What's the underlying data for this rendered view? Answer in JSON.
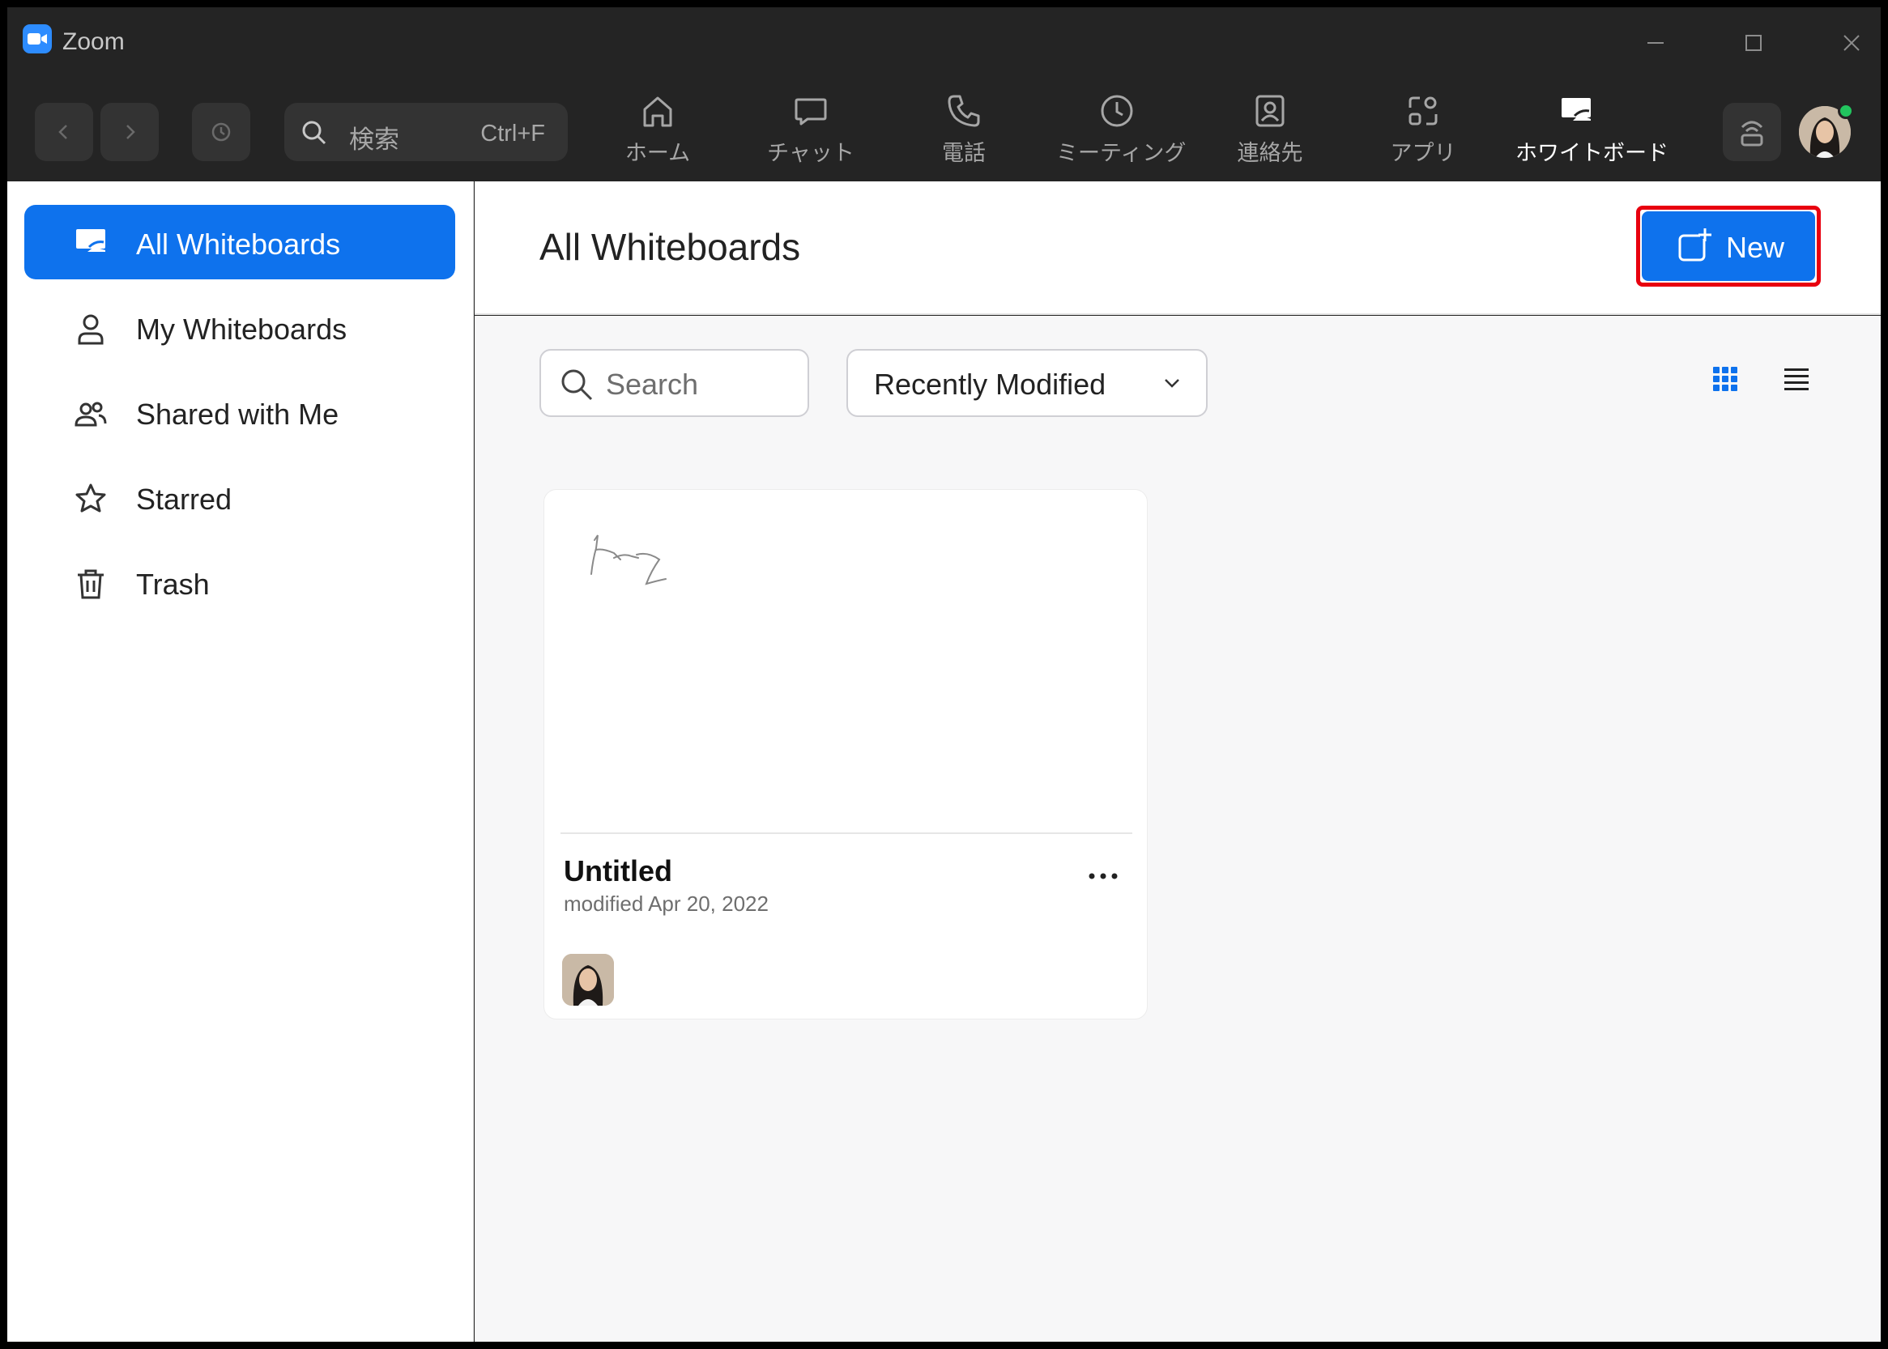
{
  "window": {
    "title": "Zoom"
  },
  "toolbar": {
    "search_placeholder": "検索",
    "search_shortcut": "Ctrl+F",
    "tabs": [
      {
        "label": "ホーム",
        "icon": "home-icon"
      },
      {
        "label": "チャット",
        "icon": "chat-icon"
      },
      {
        "label": "電話",
        "icon": "phone-icon"
      },
      {
        "label": "ミーティング",
        "icon": "clock-icon"
      },
      {
        "label": "連絡先",
        "icon": "contacts-icon"
      },
      {
        "label": "アプリ",
        "icon": "apps-icon"
      },
      {
        "label": "ホワイトボード",
        "icon": "whiteboard-icon",
        "active": true
      }
    ]
  },
  "sidebar": {
    "items": [
      {
        "label": "All Whiteboards",
        "icon": "whiteboard-icon",
        "active": true
      },
      {
        "label": "My Whiteboards",
        "icon": "person-icon"
      },
      {
        "label": "Shared with Me",
        "icon": "people-icon"
      },
      {
        "label": "Starred",
        "icon": "star-icon"
      },
      {
        "label": "Trash",
        "icon": "trash-icon"
      }
    ]
  },
  "main": {
    "title": "All Whiteboards",
    "new_button_label": "New",
    "search_placeholder": "Search",
    "sort_value": "Recently Modified",
    "cards": [
      {
        "title": "Untitled",
        "modified": "modified Apr 20, 2022"
      }
    ]
  },
  "colors": {
    "accent": "#0E72ED",
    "highlight": "#E8000F",
    "titlebar": "#242424",
    "online": "#22C55E"
  }
}
